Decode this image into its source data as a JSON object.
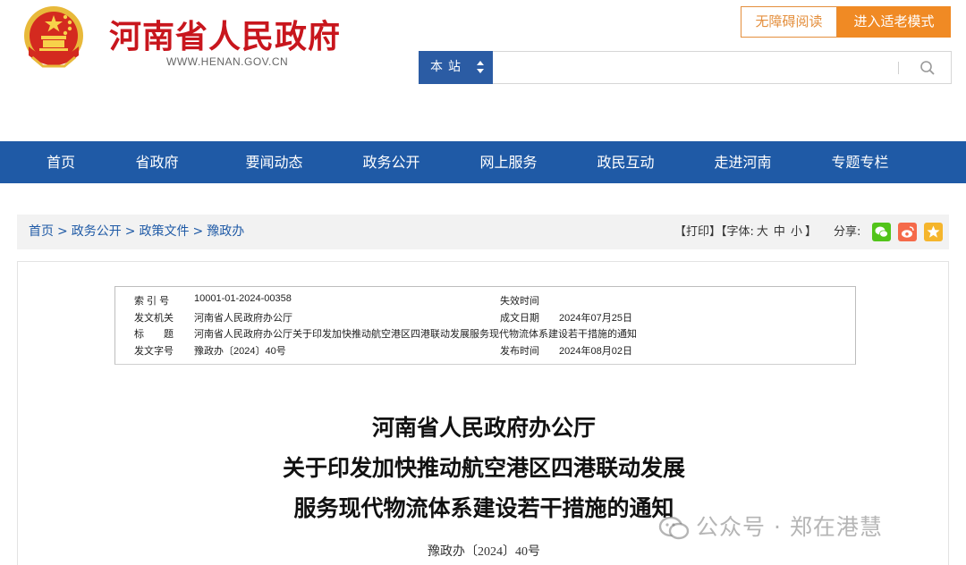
{
  "header": {
    "site_name": "河南省人民政府",
    "site_domain": "WWW.HENAN.GOV.CN",
    "accessible_label": "无障碍阅读",
    "elder_mode_label": "进入适老模式"
  },
  "search": {
    "scope_label": "本站",
    "placeholder": ""
  },
  "nav": {
    "items": [
      "首页",
      "省政府",
      "要闻动态",
      "政务公开",
      "网上服务",
      "政民互动",
      "走进河南",
      "专题专栏"
    ]
  },
  "breadcrumb": {
    "items": [
      "首页",
      "政务公开",
      "政策文件",
      "豫政办"
    ],
    "separator": ">"
  },
  "tools": {
    "print_label": "【打印】",
    "font_label": "【字体:",
    "size_large": "大",
    "size_medium": "中",
    "size_small": "小",
    "font_close": "】",
    "share_label": "分享:"
  },
  "meta": {
    "index_label": "索 引 号",
    "index_value": "10001-01-2024-00358",
    "expiry_label": "失效时间",
    "expiry_value": "",
    "issuer_label": "发文机关",
    "issuer_value": "河南省人民政府办公厅",
    "date_label": "成文日期",
    "date_value": "2024年07月25日",
    "title_label": "标　　题",
    "title_value": "河南省人民政府办公厅关于印发加快推动航空港区四港联动发展服务现代物流体系建设若干措施的通知",
    "doc_no_label": "发文字号",
    "doc_no_value": "豫政办〔2024〕40号",
    "publish_label": "发布时间",
    "publish_value": "2024年08月02日"
  },
  "document": {
    "title_line1": "河南省人民政府办公厅",
    "title_line2": "关于印发加快推动航空港区四港联动发展",
    "title_line3": "服务现代物流体系建设若干措施的通知",
    "number": "豫政办〔2024〕40号"
  },
  "watermark": {
    "text": "公众号 · 郑在港慧",
    "icon": "wechat-official-icon"
  },
  "colors": {
    "brand_red": "#c8161d",
    "nav_blue": "#1f5aa6",
    "accent_orange": "#f08a24"
  }
}
